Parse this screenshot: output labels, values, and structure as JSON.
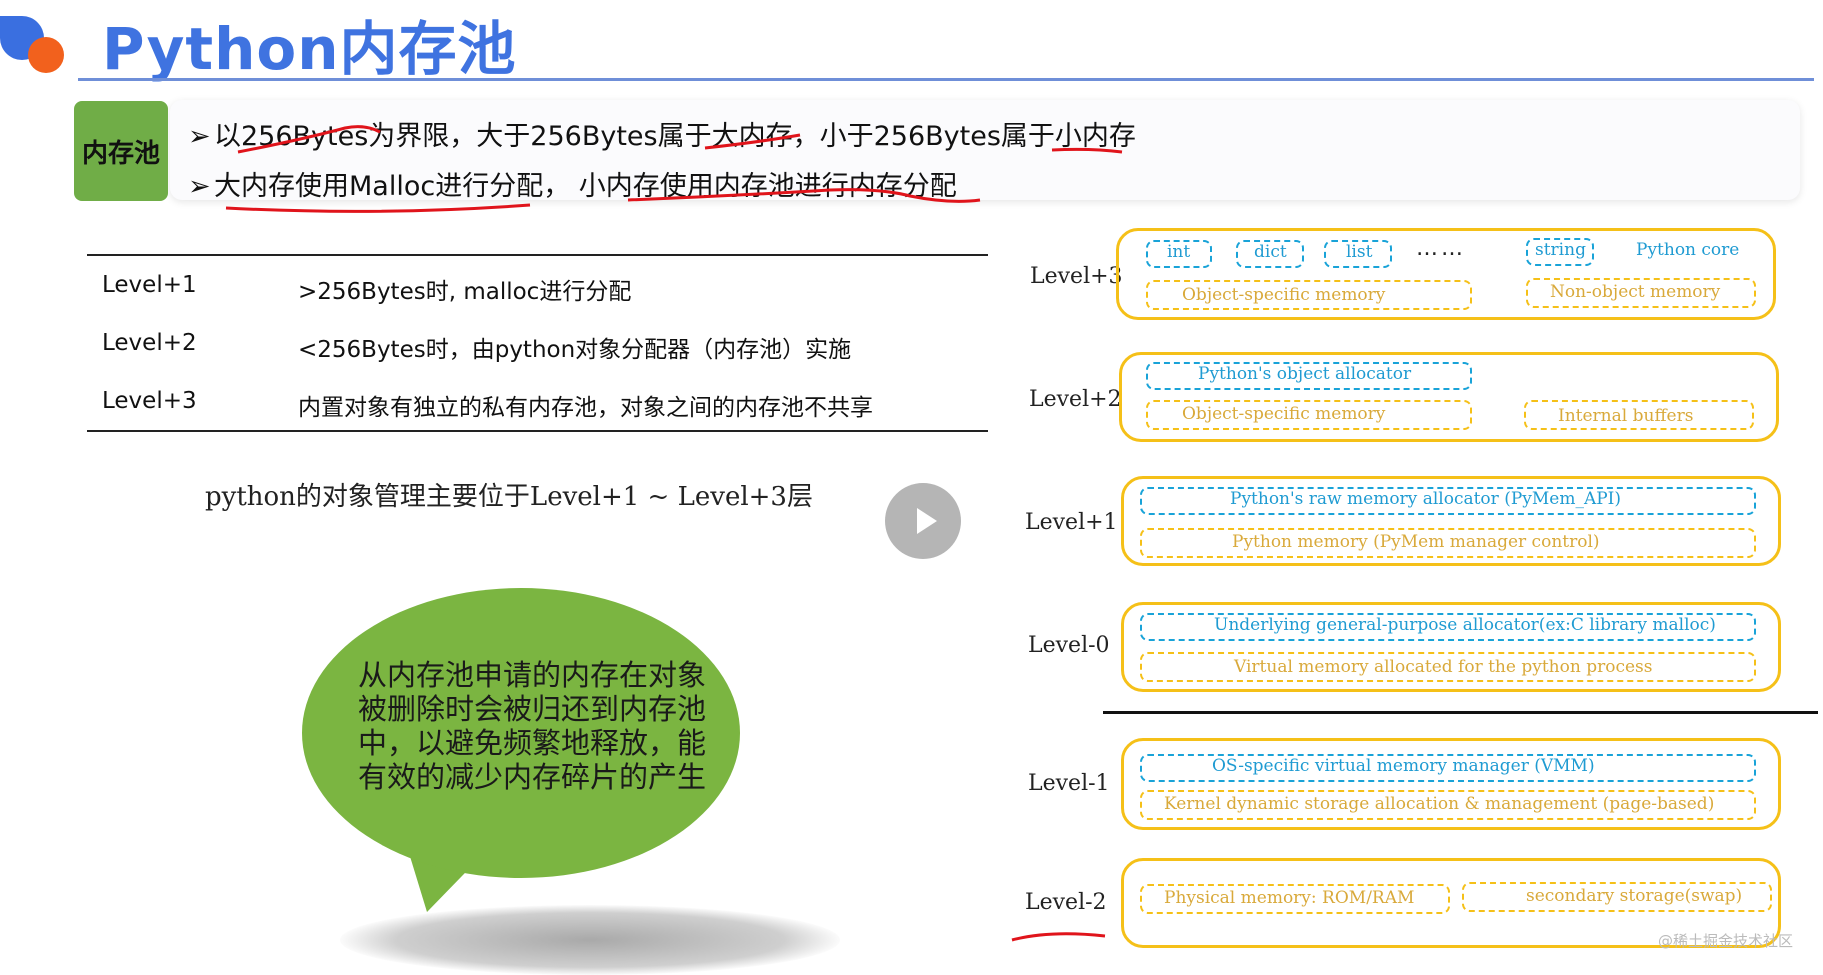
{
  "header": {
    "title": "Python内存池"
  },
  "pool": {
    "tag": "内存池",
    "bullet_mark": "➢",
    "bullets": [
      "以256Bytes为界限，大于256Bytes属于大内存，小于256Bytes属于小内存",
      "大内存使用Malloc进行分配， 小内存使用内存池进行内存分配"
    ]
  },
  "table": {
    "rows": [
      {
        "level": "Level+1",
        "desc": ">256Bytes时, malloc进行分配"
      },
      {
        "level": "Level+2",
        "desc": "<256Bytes时，由python对象分配器（内存池）实施"
      },
      {
        "level": "Level+3",
        "desc": "内置对象有独立的私有内存池，对象之间的内存池不共享"
      }
    ]
  },
  "note": "python的对象管理主要位于Level+1 ~ Level+3层",
  "bubble": {
    "text": "从内存池申请的内存在对象被删除时会被归还到内存池中，以避免频繁地释放，能有效的减少内存碎片的产生"
  },
  "diagram": {
    "level3": {
      "label": "Level+3",
      "int": "int",
      "dict": "dict",
      "list": "list",
      "dots": "……",
      "string": "string",
      "core": "Python core",
      "obj_mem": "Object-specific memory",
      "nonobj_mem": "Non-object memory"
    },
    "level2": {
      "label": "Level+2",
      "allocator": "Python's object allocator",
      "obj_mem": "Object-specific memory",
      "buffers": "Internal buffers"
    },
    "level1": {
      "label": "Level+1",
      "raw": "Python's raw memory allocator  (PyMem_API)",
      "mem": "Python memory (PyMem manager control)"
    },
    "level0": {
      "label": "Level-0",
      "alloc": "Underlying general-purpose allocator(ex:C library malloc)",
      "vmem": "Virtual memory allocated for the python process"
    },
    "levelm1": {
      "label": "Level-1",
      "vmm": "OS-specific virtual memory manager (VMM)",
      "kernel": "Kernel dynamic storage allocation & management (page-based)"
    },
    "levelm2": {
      "label": "Level-2",
      "phys": "Physical memory: ROM/RAM",
      "swap": "secondary storage(swap)"
    }
  },
  "watermark": "@稀土掘金技术社区",
  "colors": {
    "title_blue": "#3f73e0",
    "tag_green": "#70ad47",
    "outline_yellow": "#f5c018",
    "dash_blue": "#19a3d8",
    "annotation_red": "#e0141b"
  }
}
